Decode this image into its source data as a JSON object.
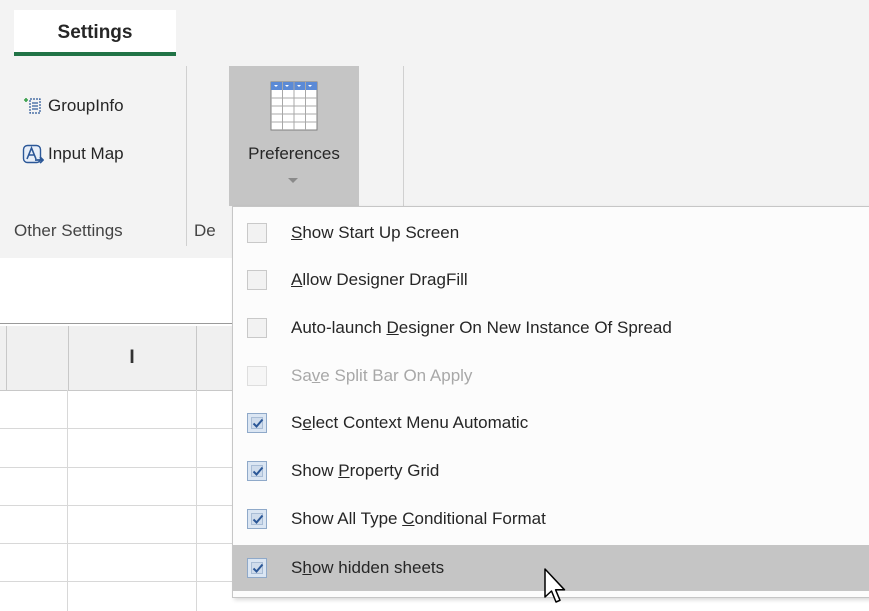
{
  "ribbon": {
    "tab_label": "Settings",
    "groups": {
      "other_settings": {
        "label": "Other Settings",
        "buttons": [
          {
            "label": "GroupInfo",
            "icon": "group-info-icon"
          },
          {
            "label": "Input Map",
            "icon": "input-map-icon"
          }
        ]
      },
      "designer": {
        "label_partial": "De",
        "preferences_label": "Preferences",
        "preferences_icon": "grid-table-icon"
      }
    }
  },
  "sheet": {
    "column_headers": [
      "I"
    ]
  },
  "menu": {
    "items": [
      {
        "pre": "",
        "key": "S",
        "post": "how Start Up Screen",
        "checked": false,
        "enabled": true,
        "highlighted": false
      },
      {
        "pre": "",
        "key": "A",
        "post": "llow Designer DragFill",
        "checked": false,
        "enabled": true,
        "highlighted": false
      },
      {
        "pre": "Auto-launch ",
        "key": "D",
        "post": "esigner On New Instance Of Spread",
        "checked": false,
        "enabled": true,
        "highlighted": false
      },
      {
        "pre": "Sa",
        "key": "v",
        "post": "e Split Bar On Apply",
        "checked": false,
        "enabled": false,
        "highlighted": false
      },
      {
        "pre": "S",
        "key": "e",
        "post": "lect Context Menu Automatic",
        "checked": true,
        "enabled": true,
        "highlighted": false
      },
      {
        "pre": "Show ",
        "key": "P",
        "post": "roperty Grid",
        "checked": true,
        "enabled": true,
        "highlighted": false
      },
      {
        "pre": "Show All Type ",
        "key": "C",
        "post": "onditional Format",
        "checked": true,
        "enabled": true,
        "highlighted": false
      },
      {
        "pre": "S",
        "key": "h",
        "post": "ow hidden sheets",
        "checked": true,
        "enabled": true,
        "highlighted": true
      }
    ]
  },
  "colors": {
    "accent_green": "#217346",
    "hover_gray": "#c5c5c5",
    "check_blue": "#2b5797"
  }
}
